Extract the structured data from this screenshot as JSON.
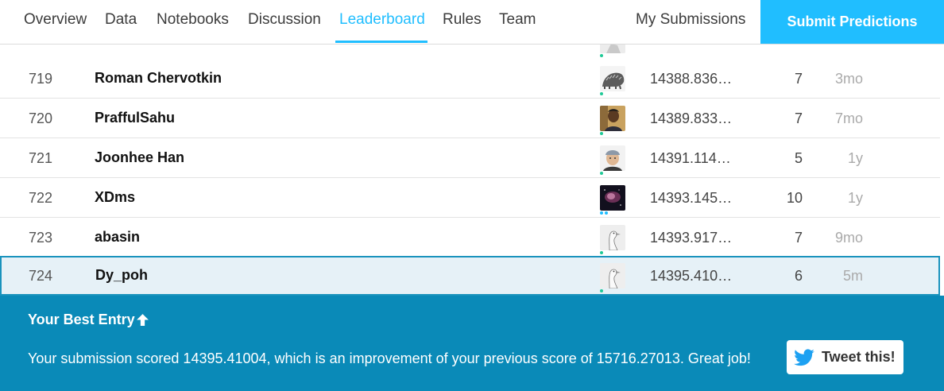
{
  "nav": {
    "tabs": [
      {
        "label": "Overview"
      },
      {
        "label": "Data"
      },
      {
        "label": "Notebooks"
      },
      {
        "label": "Discussion"
      },
      {
        "label": "Leaderboard",
        "active": true
      },
      {
        "label": "Rules"
      },
      {
        "label": "Team"
      }
    ],
    "my_submissions": "My Submissions",
    "submit": "Submit Predictions"
  },
  "leaderboard": {
    "rows": [
      {
        "rank": "719",
        "team": "Roman Chervotkin",
        "avatar": "pangolin-avatar",
        "score": "14388.836…",
        "entries": "7",
        "last": "3mo"
      },
      {
        "rank": "720",
        "team": "PraffulSahu",
        "avatar": "person-photo-avatar",
        "score": "14389.833…",
        "entries": "7",
        "last": "7mo"
      },
      {
        "rank": "721",
        "team": "Joonhee Han",
        "avatar": "person-cap-avatar",
        "score": "14391.114…",
        "entries": "5",
        "last": "1y"
      },
      {
        "rank": "722",
        "team": "XDms",
        "avatar": "nebula-avatar",
        "score": "14393.145…",
        "entries": "10",
        "last": "1y"
      },
      {
        "rank": "723",
        "team": "abasin",
        "avatar": "goose-avatar",
        "score": "14393.917…",
        "entries": "7",
        "last": "9mo"
      },
      {
        "rank": "724",
        "team": "Dy_poh",
        "avatar": "goose-avatar",
        "score": "14395.410…",
        "entries": "6",
        "last": "5m",
        "highlight": true
      }
    ]
  },
  "best_entry": {
    "title": "Your Best Entry",
    "message": "Your submission scored 14395.41004, which is an improvement of your previous score of 15716.27013. Great job!",
    "tweet": "Tweet this!"
  },
  "colors": {
    "accent": "#20beff",
    "banner": "#0a8ab8",
    "highlight_row": "#e6f1f7",
    "tier_dot": "#20c997"
  }
}
